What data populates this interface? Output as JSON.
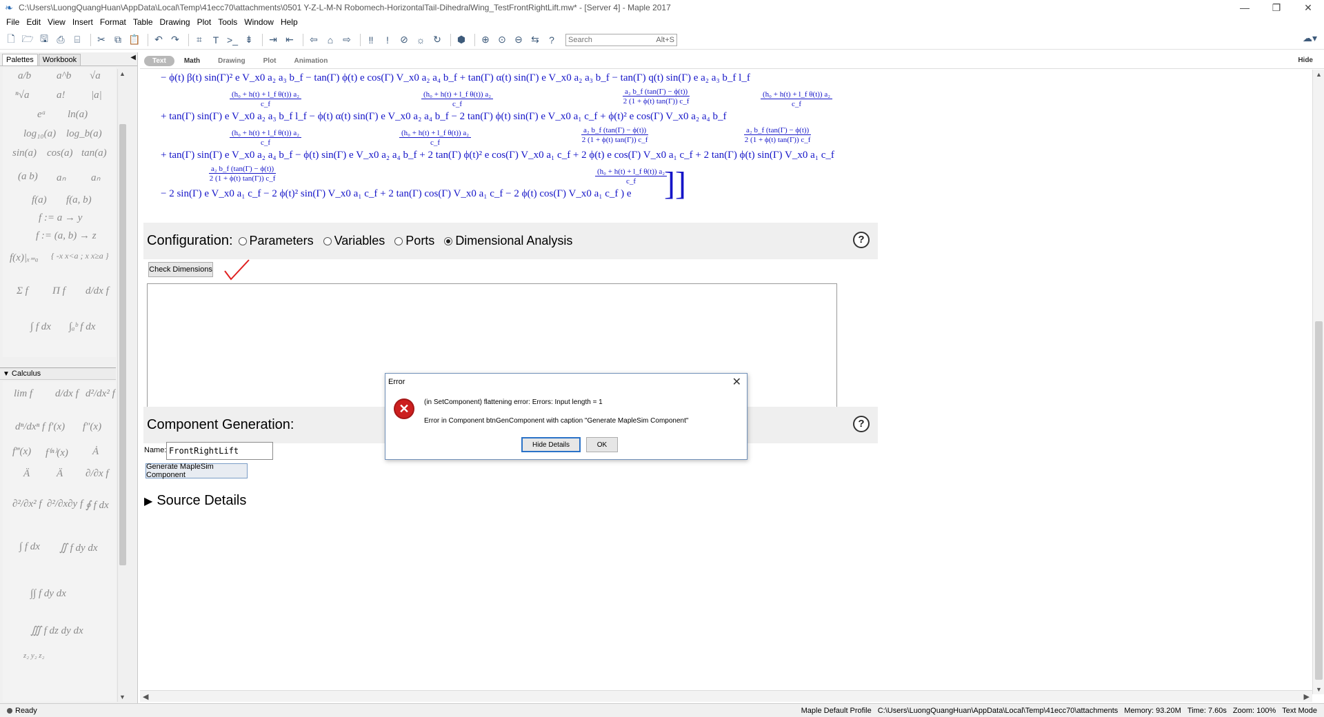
{
  "window": {
    "title": "C:\\Users\\LuongQuangHuan\\AppData\\Local\\Temp\\41ecc70\\attachments\\0501 Y-Z-L-M-N Robomech-HorizontalTail-DihedralWing_TestFrontRightLift.mw* - [Server 4] - Maple 2017",
    "controls": [
      "—",
      "❐",
      "✕"
    ]
  },
  "menu": [
    "File",
    "Edit",
    "View",
    "Insert",
    "Format",
    "Table",
    "Drawing",
    "Plot",
    "Tools",
    "Window",
    "Help"
  ],
  "toolbar": {
    "search_placeholder": "Search",
    "search_shortcut": "Alt+S"
  },
  "left_panel": {
    "tabs": [
      "Palettes",
      "Workbook"
    ],
    "expression_cells": [
      "a/b",
      "a^b",
      "√a",
      "ⁿ√a",
      "a!",
      "|a|",
      "eᵃ",
      "ln(a)",
      "log₁₀(a)",
      "log_b(a)",
      "sin(a)",
      "cos(a)",
      "tan(a)",
      "(a b)",
      "aₙ",
      "aₙ",
      "f(a)",
      "f(a, b)",
      "f := a → y",
      "f := (a, b) → z",
      "f(x)|ₓ₌ₐ",
      "{ -x x<a ; x x≥a }",
      "Σ f",
      "Π f",
      "d/dx f",
      "∫ f dx",
      "∫ₐᵇ f dx"
    ],
    "calculus_header": "Calculus",
    "calculus_cells": [
      "lim f",
      "d/dx f",
      "d²/dx² f",
      "dⁿ/dxⁿ f",
      "f′(x)",
      "f″(x)",
      "f‴(x)",
      "f⁽ⁿ⁾(x)",
      "Ȧ",
      "Ä",
      "Ä",
      "∂/∂x f",
      "∂²/∂x² f",
      "∂²/∂x∂y f",
      "∮ f dx",
      "∫ f dx",
      "∬ f dy dx",
      "∫∫ f dy dx",
      "∭ f dz dy dx",
      "z₂ y₂ z₂"
    ]
  },
  "context_bar": {
    "modes": [
      "Text",
      "Math",
      "Drawing",
      "Plot",
      "Animation"
    ],
    "active_mode": "Text",
    "hide_label": "Hide"
  },
  "math_output": {
    "line1": "− ϕ(t) β(t) sin(Γ)² e             V_x0 a₂ a₃ b_f − tan(Γ) ϕ(t) e             cos(Γ) V_x0 a₂ a₄ b_f + tan(Γ) α(t) sin(Γ) e             V_x0 a₂ a₃ b_f − tan(Γ) q(t) sin(Γ) e             a₂ a₃ b_f l_f",
    "line2": "+ tan(Γ) sin(Γ) e             V_x0 a₂ a₃ b_f l_f − ϕ(t) α(t) sin(Γ) e             V_x0 a₂ a₄ b_f − 2 tan(Γ) ϕ(t) sin(Γ) e             V_x0 a₁ c_f + ϕ(t)² e             cos(Γ) V_x0 a₂ a₄ b_f",
    "line3": "+ tan(Γ) sin(Γ) e             V_x0 a₂ a₄ b_f − ϕ(t) sin(Γ) e             V_x0 a₂ a₄ b_f + 2 tan(Γ) ϕ(t)² e             cos(Γ) V_x0 a₁ c_f + 2 ϕ(t) e             cos(Γ) V_x0 a₁ c_f + 2 tan(Γ) ϕ(t) sin(Γ) V_x0 a₁ c_f",
    "line4": "− 2 sin(Γ) e             V_x0 a₁ c_f − 2 ϕ(t)² sin(Γ) V_x0 a₁ c_f + 2 tan(Γ) cos(Γ) V_x0 a₁ c_f − 2 ϕ(t) cos(Γ) V_x0 a₁ c_f ) e",
    "frac_exp_num": "(h₀ + h(t) + l_f θ(t)) a₂",
    "frac_exp_den": "c_f",
    "frac_tan_num": "a₂ b_f (tan(Γ) − ϕ(t))",
    "frac_tan_den": "2 (1 + ϕ(t) tan(Γ)) c_f"
  },
  "configuration": {
    "title": "Configuration:",
    "options": [
      "Parameters",
      "Variables",
      "Ports",
      "Dimensional Analysis"
    ],
    "selected": "Dimensional Analysis",
    "help": "?"
  },
  "check_dimensions_label": "Check Dimensions",
  "component_generation": {
    "title": "Component Generation:",
    "help": "?",
    "name_label": "Name:",
    "name_value": "FrontRightLift",
    "generate_label": "Generate MapleSim Component"
  },
  "source_details_label": "Source Details",
  "error_dialog": {
    "title": "Error",
    "close": "✕",
    "message1": "(in SetComponent) flattening error: Errors: Input length = 1",
    "message2": "Error in Component btnGenComponent with caption \"Generate MapleSim Component\"",
    "hide_details_label": "Hide Details",
    "ok_label": "OK"
  },
  "status_bar": {
    "left": "Ready",
    "profile": "Maple Default Profile",
    "path": "C:\\Users\\LuongQuangHuan\\AppData\\Local\\Temp\\41ecc70\\attachments",
    "memory": "Memory: 93.20M",
    "time": "Time: 7.60s",
    "zoom": "Zoom: 100%",
    "mode": "Text Mode"
  }
}
